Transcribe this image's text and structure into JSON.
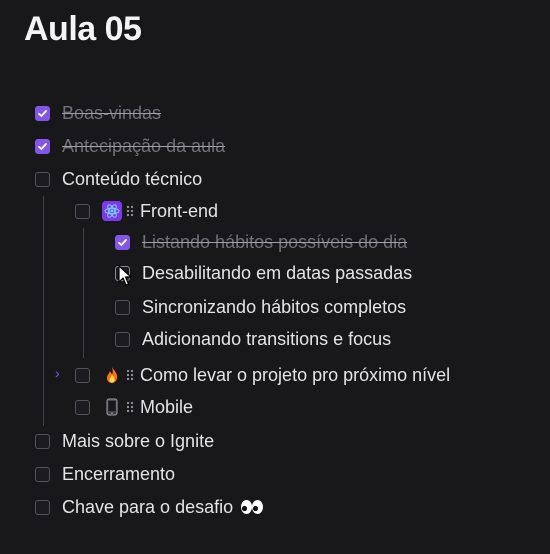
{
  "page": {
    "title": "Aula 05"
  },
  "items": [
    {
      "label": "Boas-vindas",
      "checked": true
    },
    {
      "label": "Antecipação da aula",
      "checked": true
    },
    {
      "label": "Conteúdo técnico",
      "checked": false
    },
    {
      "label": "Front-end",
      "checked": false,
      "icon": "react-icon"
    },
    {
      "label": "Listando hábitos possíveis do dia",
      "checked": true
    },
    {
      "label": "Desabilitando em datas passadas",
      "checked": false
    },
    {
      "label": "Sincronizando hábitos completos",
      "checked": false
    },
    {
      "label": "Adicionando transitions e focus",
      "checked": false
    },
    {
      "label": "Como levar o projeto pro próximo nível",
      "checked": false,
      "icon": "fire-icon",
      "collapsed": true
    },
    {
      "label": "Mobile",
      "checked": false,
      "icon": "mobile-phone-icon"
    },
    {
      "label": "Mais sobre o Ignite",
      "checked": false
    },
    {
      "label": "Encerramento",
      "checked": false
    },
    {
      "label": "Chave para o desafio",
      "checked": false,
      "icon": "eyes-icon"
    }
  ],
  "colors": {
    "background": "#18181b",
    "accent": "#8257e5",
    "text": "#e4e4e7",
    "text_done": "#71717a"
  }
}
